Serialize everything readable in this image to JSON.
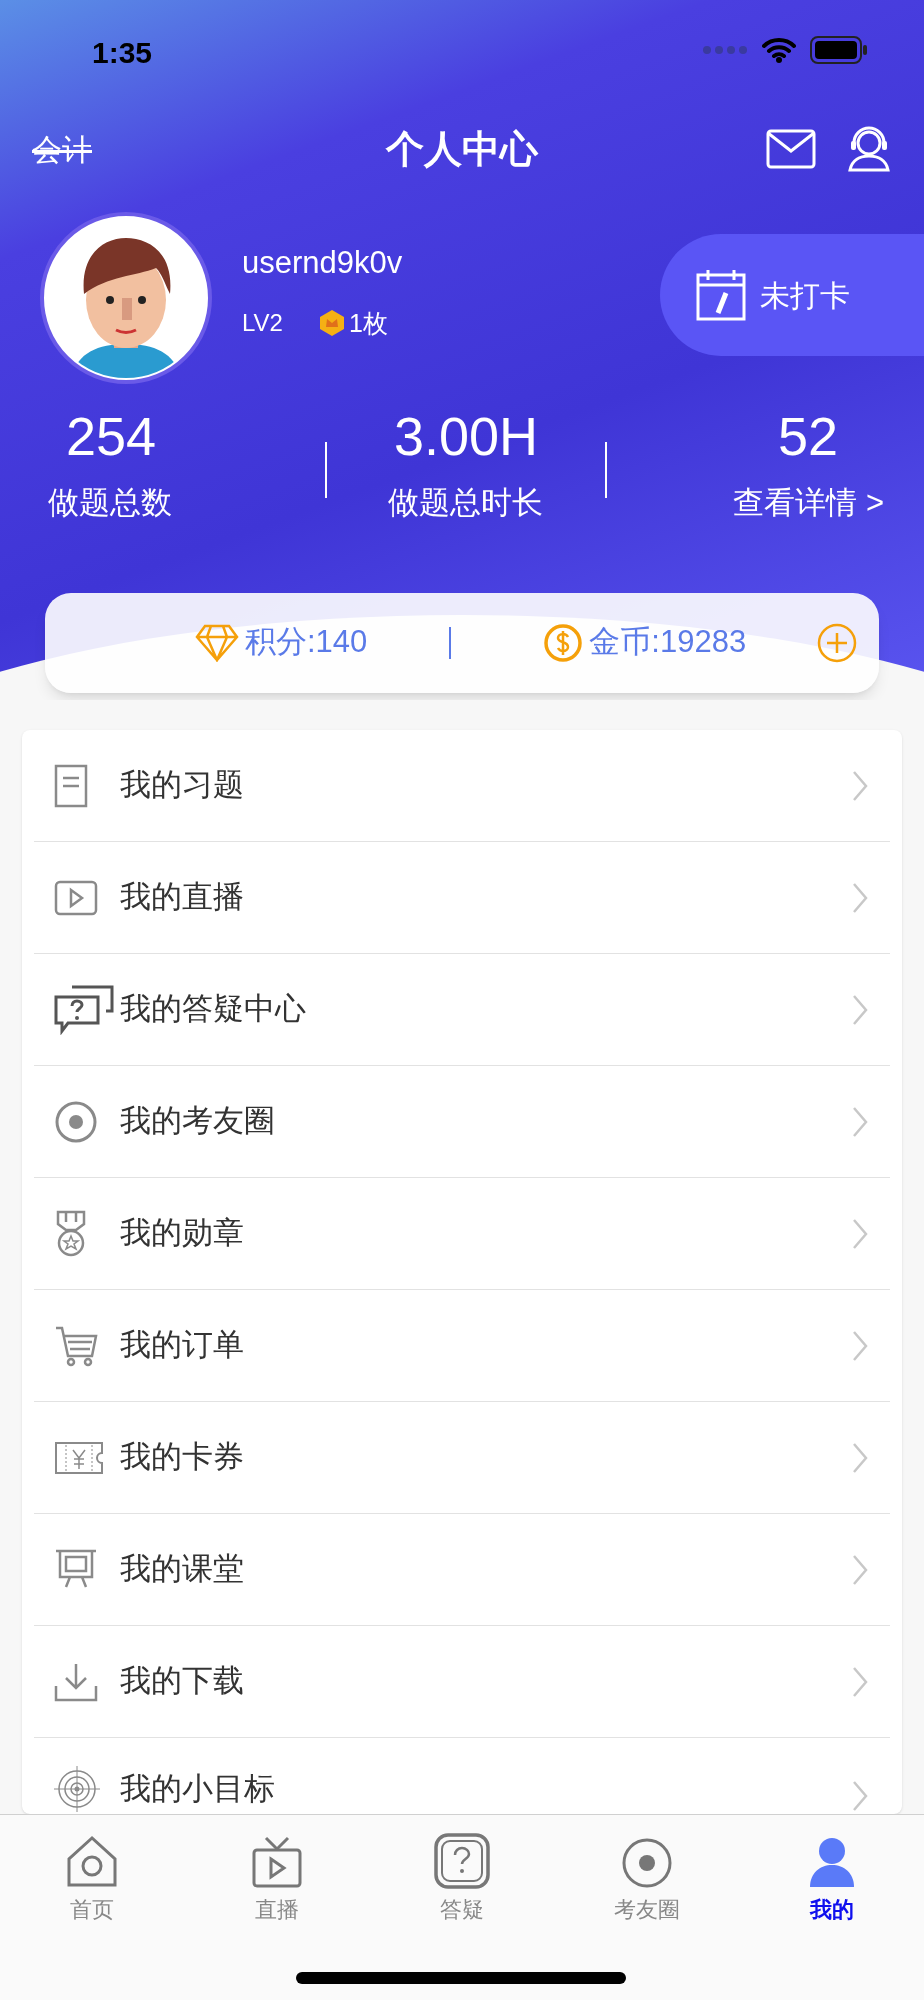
{
  "status_bar": {
    "time": "1:35"
  },
  "header": {
    "left_label": "会计",
    "title": "个人中心"
  },
  "profile": {
    "username": "usernd9k0v",
    "level": "LV2",
    "badge_count": "1枚",
    "checkin_label": "未打卡"
  },
  "stats": [
    {
      "value": "254",
      "label": "做题总数"
    },
    {
      "value": "3.00H",
      "label": "做题总时长"
    },
    {
      "value": "52",
      "label": "查看详情 >"
    }
  ],
  "wallet": {
    "points": "积分:140",
    "coins": "金币:19283"
  },
  "menu": [
    {
      "label": "我的习题"
    },
    {
      "label": "我的直播"
    },
    {
      "label": "我的答疑中心"
    },
    {
      "label": "我的考友圈"
    },
    {
      "label": "我的勋章"
    },
    {
      "label": "我的订单"
    },
    {
      "label": "我的卡券"
    },
    {
      "label": "我的课堂"
    },
    {
      "label": "我的下载"
    },
    {
      "label": "我的小目标"
    }
  ],
  "tab_bar": [
    {
      "label": "首页",
      "selected": false
    },
    {
      "label": "直播",
      "selected": false
    },
    {
      "label": "答疑",
      "selected": false
    },
    {
      "label": "考友圈",
      "selected": false
    },
    {
      "label": "我的",
      "selected": true
    }
  ]
}
